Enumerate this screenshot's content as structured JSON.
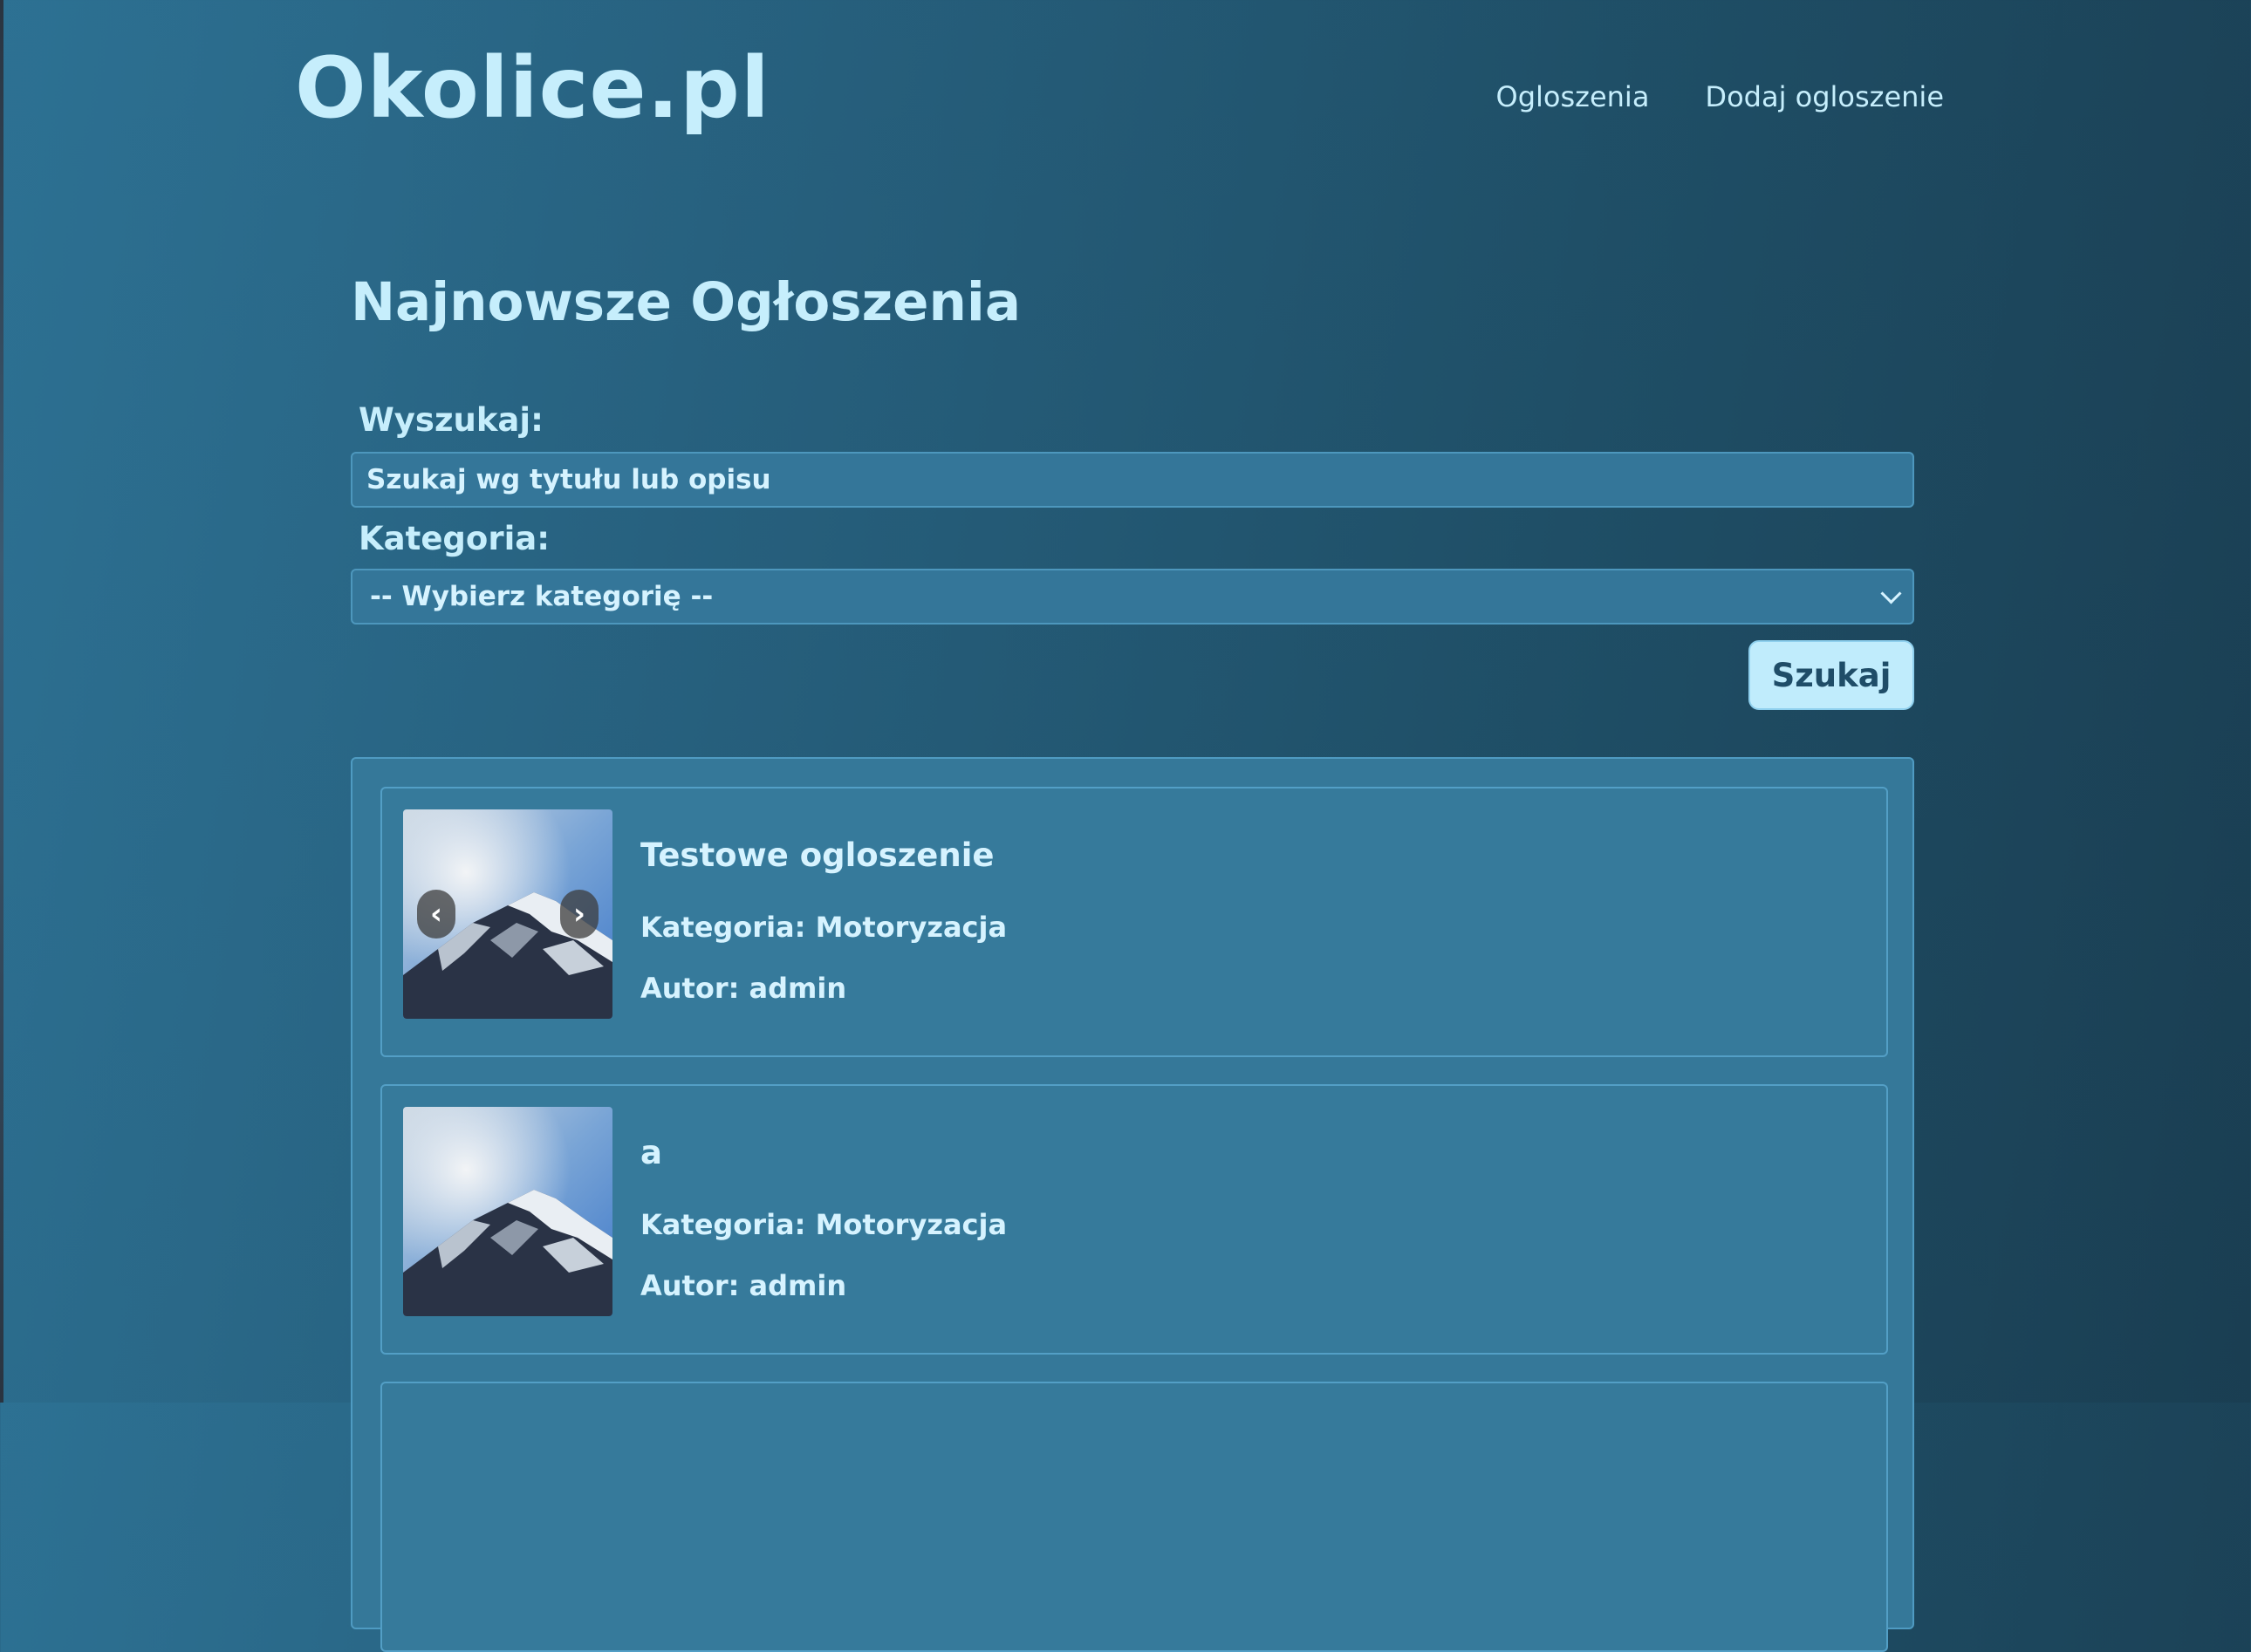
{
  "header": {
    "logo": "Okolice.pl",
    "nav": [
      "Ogloszenia",
      "Dodaj ogloszenie"
    ]
  },
  "main": {
    "title": "Najnowsze Ogłoszenia",
    "search_label": "Wyszukaj:",
    "search_placeholder": "Szukaj wg tytułu lub opisu",
    "category_label": "Kategoria:",
    "category_selected": "-- Wybierz kategorię --",
    "search_button": "Szukaj"
  },
  "listings": [
    {
      "title": "Testowe ogloszenie",
      "category_prefix": "Kategoria:",
      "category": "Motoryzacja",
      "author_prefix": "Autor:",
      "author": "admin",
      "has_carousel": true
    },
    {
      "title": "a",
      "category_prefix": "Kategoria:",
      "category": "Motoryzacja",
      "author_prefix": "Autor:",
      "author": "admin",
      "has_carousel": false
    }
  ],
  "carousel": {
    "prev_glyph": "‹",
    "next_glyph": "›"
  },
  "colors": {
    "background_start": "#2d7193",
    "background_end": "#1a3e52",
    "text": "#c6eefc",
    "panel": "#357899",
    "button": "#c0ecfc",
    "button_text": "#1f4d68"
  }
}
